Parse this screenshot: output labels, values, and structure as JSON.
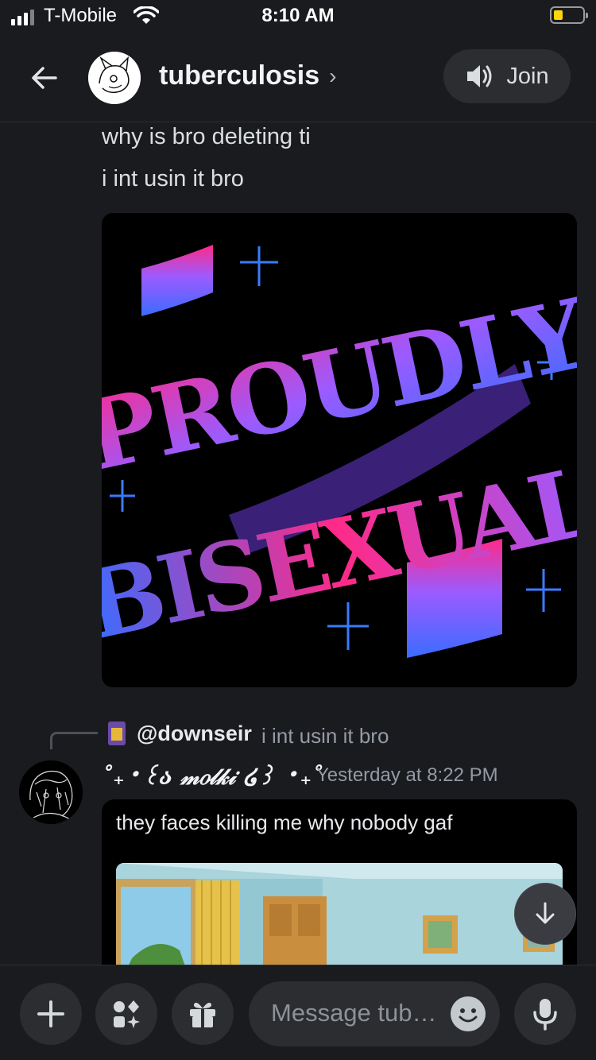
{
  "status_bar": {
    "carrier": "T-Mobile",
    "time": "8:10 AM",
    "battery_level": 0.2,
    "battery_color": "#ffd60a"
  },
  "header": {
    "back_icon": "arrow-left-icon",
    "channel_name": "tuberculosis",
    "chevron": "›",
    "join_label": "Join",
    "join_icon": "speaker-icon"
  },
  "messages": {
    "lines": [
      "why is bro deleting ti",
      "i int usin it bro"
    ],
    "image": {
      "line1": "PROUDLY",
      "line2": "BISEXUAL",
      "colors": {
        "pink": "#ff2a88",
        "purple": "#9b5bff",
        "blue": "#3a6cff"
      }
    },
    "reply": {
      "user": "@downseir",
      "text": "i int usin it bro"
    },
    "author": {
      "name": "˚₊‧꒰ა 𝓂𝑜𝓁𝓀𝒾 ໒꒱ ‧₊˚",
      "timestamp": "Yesterday at 8:22 PM"
    },
    "bubble_text": "they faces killing me why nobody gaf"
  },
  "composer": {
    "placeholder": "Message tub…",
    "icons": [
      "plus-icon",
      "apps-icon",
      "gift-icon",
      "emoji-icon",
      "microphone-icon"
    ]
  },
  "accent": {
    "bg": "#1a1b1f",
    "surface": "#2b2d31"
  }
}
